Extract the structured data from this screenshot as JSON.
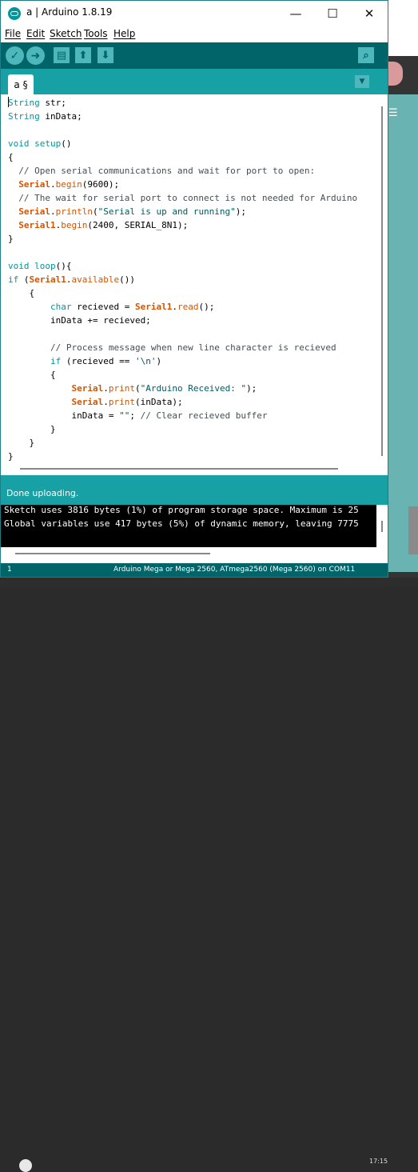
{
  "window": {
    "title": "a | Arduino 1.8.19",
    "controls": {
      "minimize": "—",
      "maximize": "☐",
      "close": "✕"
    }
  },
  "menu": [
    "File",
    "Edit",
    "Sketch",
    "Tools",
    "Help"
  ],
  "toolbar": {
    "verify_icon": "check-icon",
    "upload_icon": "arrow-right-icon",
    "new_icon": "page-icon",
    "open_icon": "arrow-up-icon",
    "save_icon": "arrow-down-icon",
    "serial_monitor_icon": "magnifier-icon"
  },
  "tab": {
    "label": "a §",
    "menu_icon": "triangle-down-icon"
  },
  "code_lines": [
    "String str;",
    "String inData;",
    "",
    "void setup()",
    "{",
    "  // Open serial communications and wait for port to open:",
    "  Serial.begin(9600);",
    "  // The wait for serial port to connect is not needed for Arduino",
    "  Serial.println(\"Serial is up and running\");",
    "  Serial1.begin(2400, SERIAL_8N1);",
    "}",
    "",
    "void loop(){",
    "if (Serial1.available())",
    "    {",
    "        char recieved = Serial1.read();",
    "        inData += recieved;",
    "",
    "        // Process message when new line character is recieved",
    "        if (recieved == '\\n')",
    "        {",
    "            Serial.print(\"Arduino Received: \");",
    "            Serial.print(inData);",
    "            inData = \"\"; // Clear recieved buffer",
    "        }",
    "    }",
    "}"
  ],
  "status": {
    "message": "Done uploading."
  },
  "console": {
    "lines": [
      "Sketch uses 3816 bytes (1%) of program storage space. Maximum is 25",
      "Global variables use 417 bytes (5%) of dynamic memory, leaving 7775"
    ]
  },
  "footer": {
    "line": "1",
    "board": "Arduino Mega or Mega 2560, ATmega2560 (Mega 2560) on COM11"
  },
  "taskbar": {
    "clock": "17:15"
  },
  "colors": {
    "accent_dark": "#006468",
    "accent": "#17a1a5",
    "keyword": "#00979c",
    "serial": "#d35400",
    "comment": "#434f54"
  }
}
